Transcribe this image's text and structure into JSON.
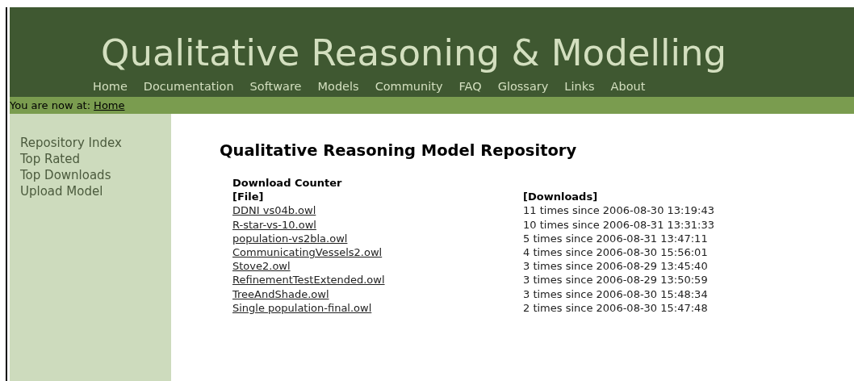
{
  "site_title": "Qualitative Reasoning & Modelling",
  "nav": [
    "Home",
    "Documentation",
    "Software",
    "Models",
    "Community",
    "FAQ",
    "Glossary",
    "Links",
    "About"
  ],
  "breadcrumb": {
    "prefix": "You are now at:",
    "link": "Home"
  },
  "sidebar": {
    "items": [
      "Repository Index",
      "Top Rated",
      "Top Downloads",
      "Upload Model"
    ]
  },
  "heading": "Qualitative Reasoning Model Repository",
  "table": {
    "caption": "Download Counter",
    "columns": [
      "[File]",
      "[Downloads]"
    ],
    "rows": [
      {
        "file": "DDNI vs04b.owl",
        "downloads": "11 times since 2006-08-30 13:19:43"
      },
      {
        "file": "R-star-vs-10.owl",
        "downloads": "10 times since 2006-08-31 13:31:33"
      },
      {
        "file": "population-vs2bla.owl",
        "downloads": "5 times since 2006-08-31 13:47:11"
      },
      {
        "file": "CommunicatingVessels2.owl",
        "downloads": "4 times since 2006-08-30 15:56:01"
      },
      {
        "file": "Stove2.owl",
        "downloads": "3 times since 2006-08-29 13:45:40"
      },
      {
        "file": "RefinementTestExtended.owl",
        "downloads": "3 times since 2006-08-29 13:50:59"
      },
      {
        "file": "TreeAndShade.owl",
        "downloads": "3 times since 2006-08-30 15:48:34"
      },
      {
        "file": "Single population-final.owl",
        "downloads": "2 times since 2006-08-30 15:47:48"
      }
    ]
  }
}
